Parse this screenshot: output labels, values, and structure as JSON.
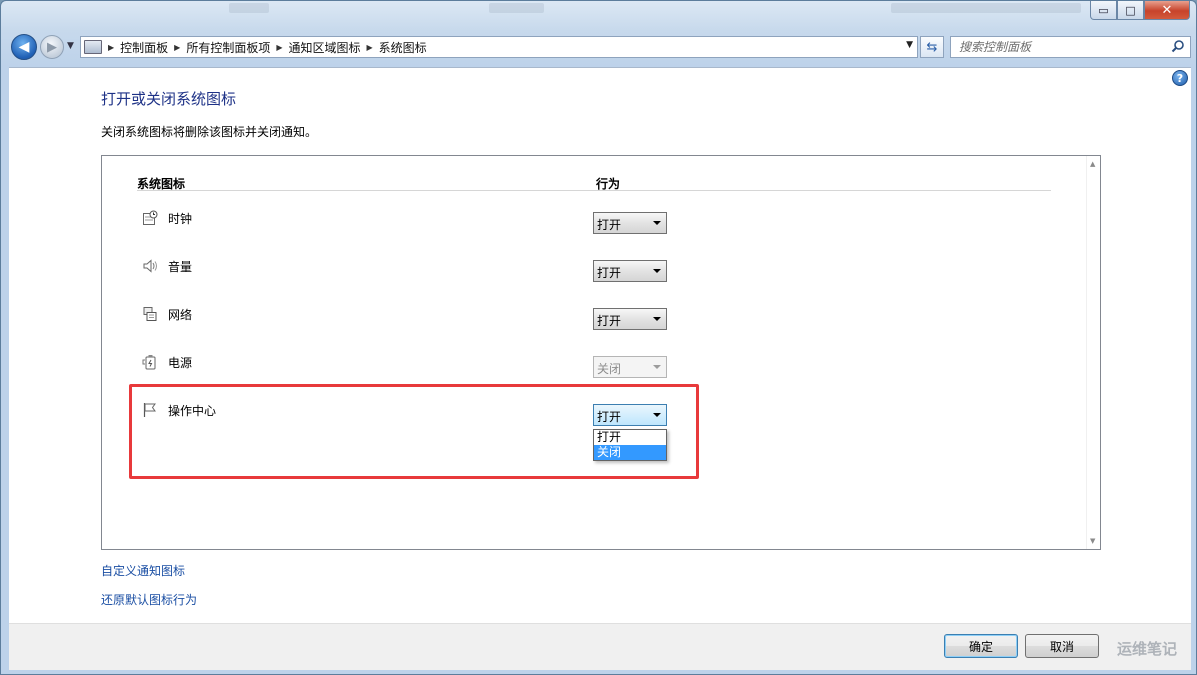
{
  "window": {
    "caption_buttons": {
      "minimize": "▭",
      "maximize": "□",
      "close": "✕"
    }
  },
  "address_bar": {
    "breadcrumbs": [
      "控制面板",
      "所有控制面板项",
      "通知区域图标",
      "系统图标"
    ],
    "search_placeholder": "搜索控制面板"
  },
  "page": {
    "title": "打开或关闭系统图标",
    "subtitle": "关闭系统图标将删除该图标并关闭通知。",
    "columns": {
      "icon": "系统图标",
      "behavior": "行为"
    },
    "rows": [
      {
        "label": "时钟",
        "icon": "clock-icon",
        "value": "打开",
        "state": "enabled"
      },
      {
        "label": "音量",
        "icon": "volume-icon",
        "value": "打开",
        "state": "enabled"
      },
      {
        "label": "网络",
        "icon": "network-icon",
        "value": "打开",
        "state": "enabled"
      },
      {
        "label": "电源",
        "icon": "power-icon",
        "value": "关闭",
        "state": "disabled"
      },
      {
        "label": "操作中心",
        "icon": "flag-icon",
        "value": "打开",
        "state": "active"
      }
    ],
    "dropdown_options": [
      "打开",
      "关闭"
    ],
    "dropdown_selected": "关闭",
    "links": {
      "customize": "自定义通知图标",
      "restore": "还原默认图标行为"
    }
  },
  "footer": {
    "ok": "确定",
    "cancel": "取消",
    "watermark": "运维笔记"
  },
  "colors": {
    "highlight": "#e8393b",
    "link": "#1a4ea3",
    "title": "#1e3287",
    "selection": "#3399ff"
  }
}
